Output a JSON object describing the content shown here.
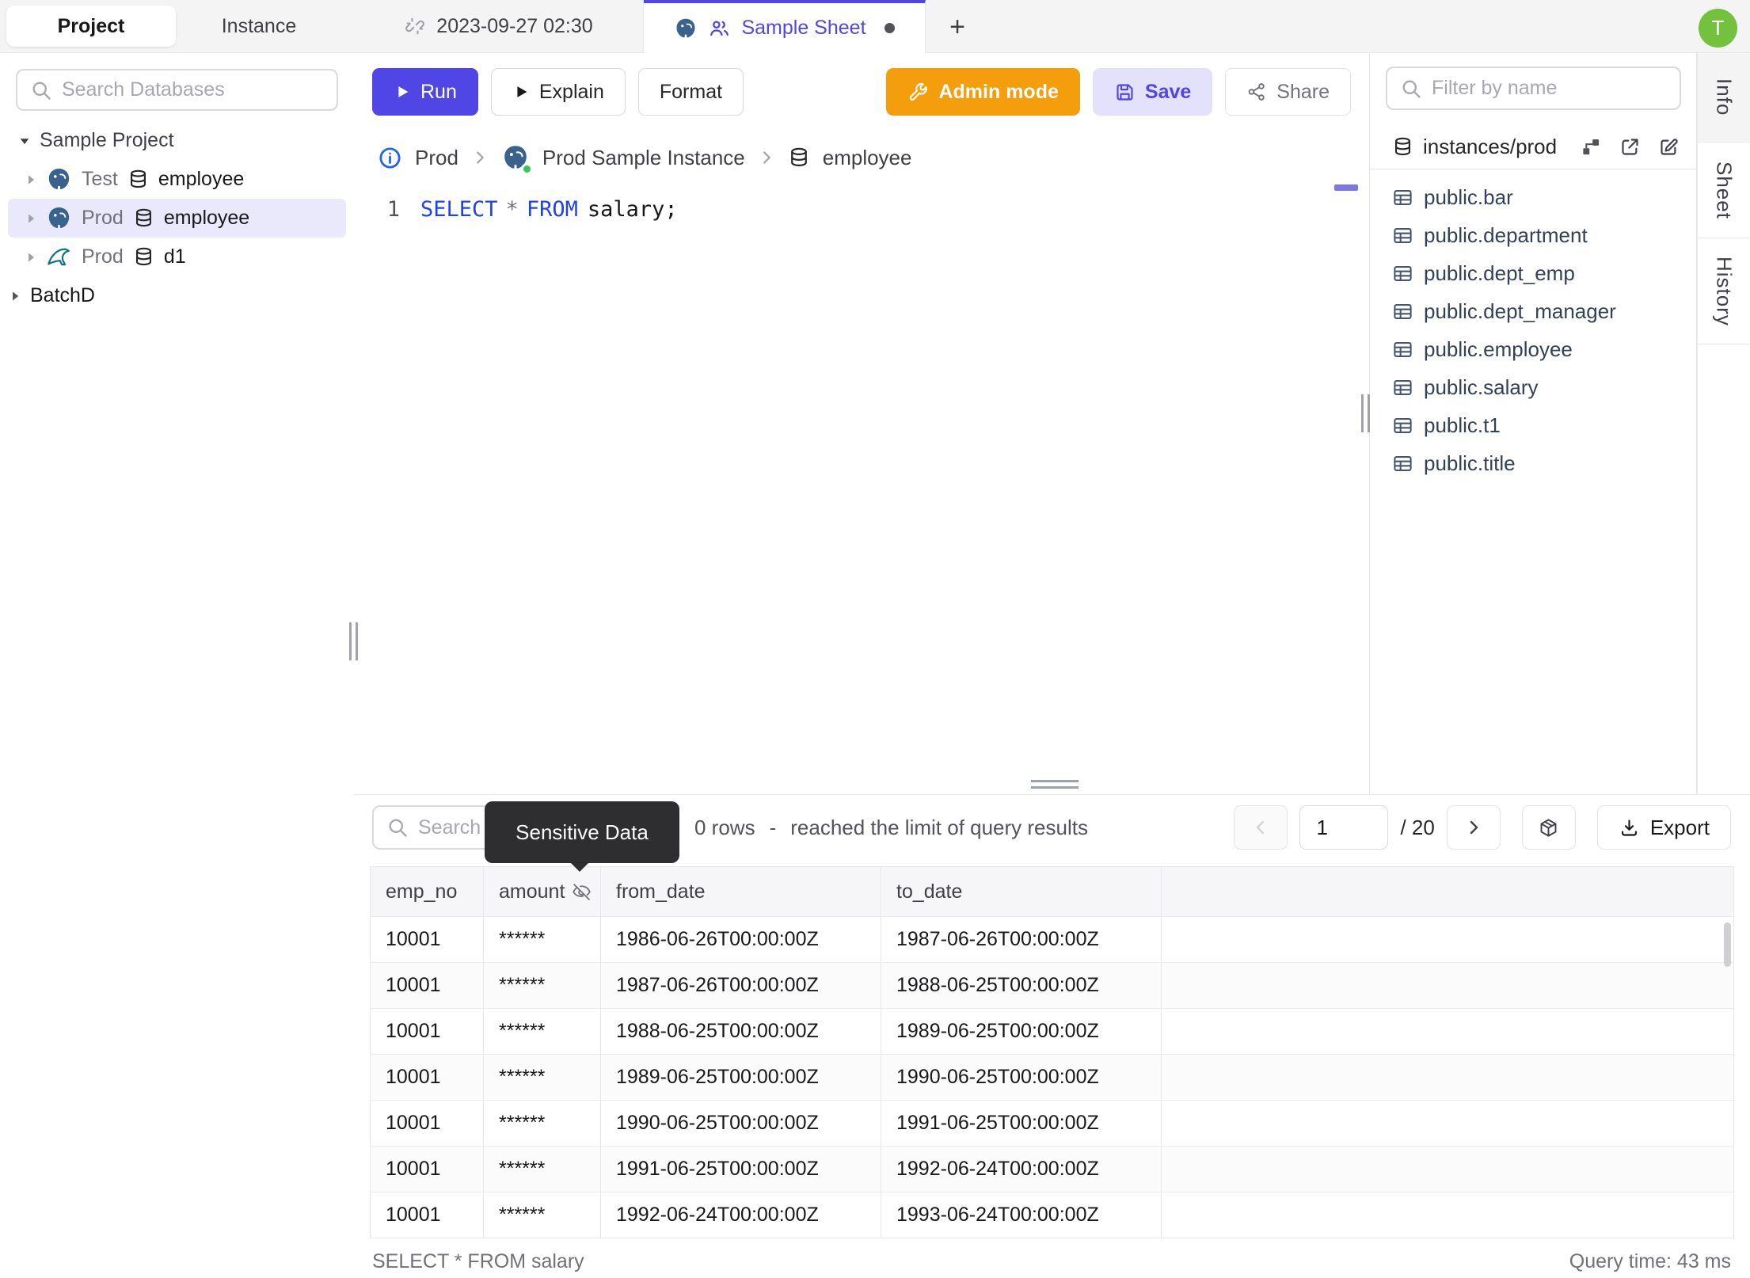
{
  "colors": {
    "accent_indigo": "#4f46e5",
    "admin_amber": "#f49e0d",
    "save_bg": "#e3e1fb",
    "selected_row_bg": "#eae9fc",
    "avatar_green": "#74c13e",
    "sql_keyword_blue": "#2240f0",
    "tooltip_bg": "#27272a"
  },
  "topbar": {
    "side_tabs": {
      "project": "Project",
      "instance": "Instance"
    },
    "tab_timestamp": "2023-09-27 02:30",
    "tab_sheet": "Sample Sheet",
    "new_tab": "+",
    "avatar_initial": "T"
  },
  "sidebar": {
    "search_placeholder": "Search Databases",
    "tree": {
      "root": "Sample Project",
      "items": [
        {
          "env": "Test",
          "db": "employee"
        },
        {
          "env": "Prod",
          "db": "employee"
        },
        {
          "env": "Prod",
          "db": "d1"
        }
      ],
      "leaf": "BatchD"
    }
  },
  "toolbar": {
    "run": "Run",
    "explain": "Explain",
    "format": "Format",
    "admin_mode": "Admin mode",
    "save": "Save",
    "share": "Share"
  },
  "breadcrumb": {
    "env": "Prod",
    "instance": "Prod Sample Instance",
    "database": "employee"
  },
  "editor": {
    "line_number": "1",
    "sql_select": "SELECT",
    "sql_star": "*",
    "sql_from": "FROM",
    "sql_rest": "salary;"
  },
  "right_panel": {
    "filter_placeholder": "Filter by name",
    "header": "instances/prod",
    "tables": [
      "public.bar",
      "public.department",
      "public.dept_emp",
      "public.dept_manager",
      "public.employee",
      "public.salary",
      "public.t1",
      "public.title"
    ]
  },
  "side_tabs": {
    "info": "Info",
    "sheet": "Sheet",
    "history": "History"
  },
  "results": {
    "search_placeholder": "Search",
    "tooltip": "Sensitive Data",
    "rows_count": "0 rows",
    "dash": "-",
    "limit_text": "reached the limit of query results",
    "page": "1",
    "page_total": "/ 20",
    "export_label": "Export",
    "columns": [
      "emp_no",
      "amount",
      "from_date",
      "to_date"
    ],
    "rows": [
      [
        "10001",
        "******",
        "1986-06-26T00:00:00Z",
        "1987-06-26T00:00:00Z"
      ],
      [
        "10001",
        "******",
        "1987-06-26T00:00:00Z",
        "1988-06-25T00:00:00Z"
      ],
      [
        "10001",
        "******",
        "1988-06-25T00:00:00Z",
        "1989-06-25T00:00:00Z"
      ],
      [
        "10001",
        "******",
        "1989-06-25T00:00:00Z",
        "1990-06-25T00:00:00Z"
      ],
      [
        "10001",
        "******",
        "1990-06-25T00:00:00Z",
        "1991-06-25T00:00:00Z"
      ],
      [
        "10001",
        "******",
        "1991-06-25T00:00:00Z",
        "1992-06-24T00:00:00Z"
      ],
      [
        "10001",
        "******",
        "1992-06-24T00:00:00Z",
        "1993-06-24T00:00:00Z"
      ]
    ],
    "status_query": "SELECT * FROM salary",
    "status_time": "Query time: 43 ms"
  }
}
